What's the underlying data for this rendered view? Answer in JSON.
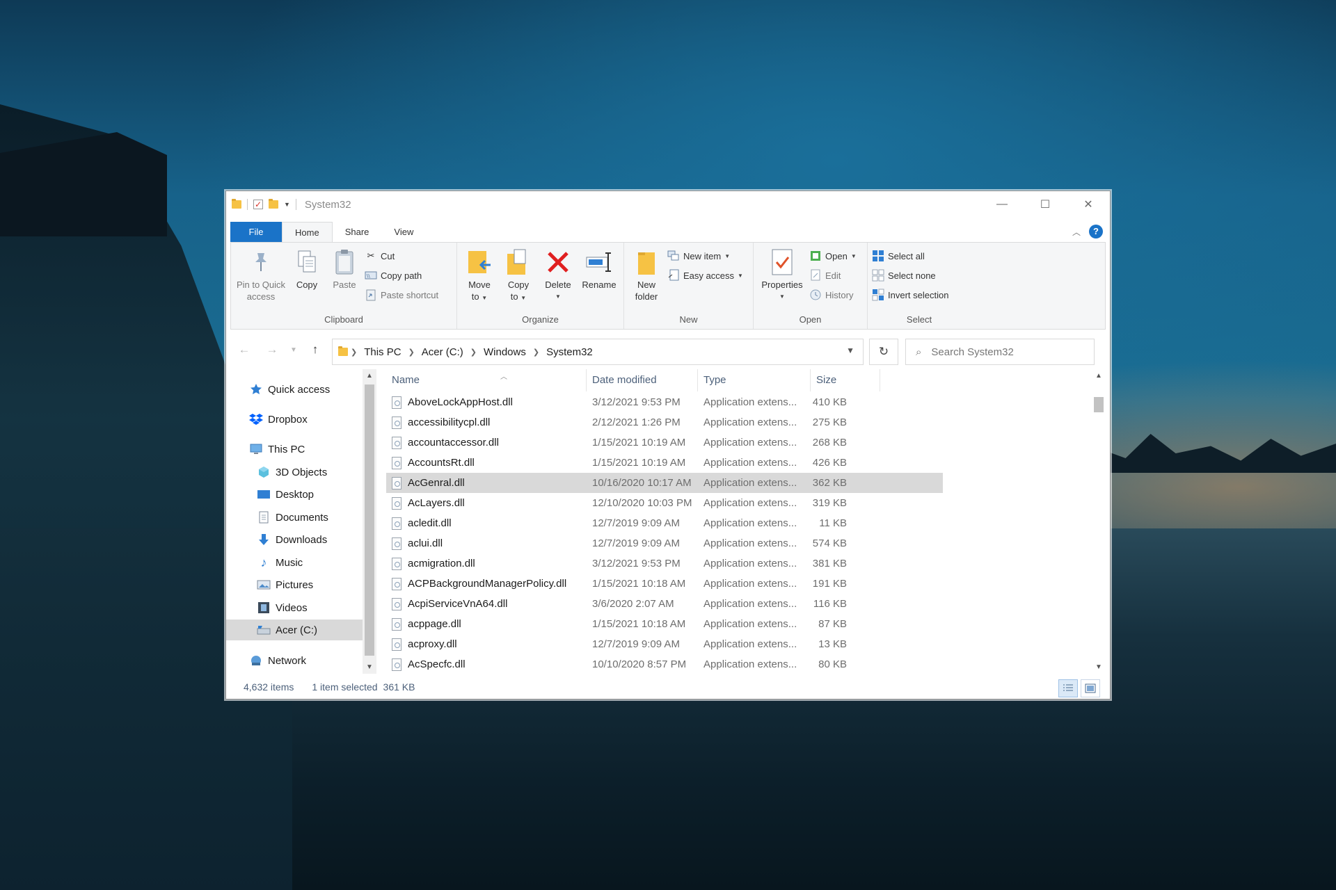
{
  "window": {
    "title": "System32",
    "controls": {
      "minimize": "—",
      "maximize": "☐",
      "close": "✕"
    }
  },
  "ribbon_tabs": [
    "File",
    "Home",
    "Share",
    "View"
  ],
  "ribbon": {
    "clipboard": {
      "label": "Clipboard",
      "pin_line1": "Pin to Quick",
      "pin_line2": "access",
      "copy": "Copy",
      "paste": "Paste",
      "cut": "Cut",
      "copy_path": "Copy path",
      "paste_shortcut": "Paste shortcut"
    },
    "organize": {
      "label": "Organize",
      "move_line1": "Move",
      "move_line2": "to",
      "copy_line1": "Copy",
      "copy_line2": "to",
      "delete": "Delete",
      "rename": "Rename"
    },
    "new": {
      "label": "New",
      "folder_line1": "New",
      "folder_line2": "folder",
      "new_item": "New item",
      "easy_access": "Easy access"
    },
    "open": {
      "label": "Open",
      "properties": "Properties",
      "open": "Open",
      "edit": "Edit",
      "history": "History"
    },
    "select": {
      "label": "Select",
      "select_all": "Select all",
      "select_none": "Select none",
      "invert": "Invert selection"
    }
  },
  "address": {
    "crumbs": [
      "This PC",
      "Acer (C:)",
      "Windows",
      "System32"
    ],
    "search_placeholder": "Search System32"
  },
  "nav": {
    "quick_access": "Quick access",
    "dropbox": "Dropbox",
    "this_pc": "This PC",
    "objects3d": "3D Objects",
    "desktop": "Desktop",
    "documents": "Documents",
    "downloads": "Downloads",
    "music": "Music",
    "pictures": "Pictures",
    "videos": "Videos",
    "drive": "Acer (C:)",
    "network": "Network"
  },
  "columns": {
    "name": "Name",
    "date": "Date modified",
    "type": "Type",
    "size": "Size"
  },
  "files": [
    {
      "name": "AboveLockAppHost.dll",
      "date": "3/12/2021 9:53 PM",
      "type": "Application extens...",
      "size": "410 KB"
    },
    {
      "name": "accessibilitycpl.dll",
      "date": "2/12/2021 1:26 PM",
      "type": "Application extens...",
      "size": "275 KB"
    },
    {
      "name": "accountaccessor.dll",
      "date": "1/15/2021 10:19 AM",
      "type": "Application extens...",
      "size": "268 KB"
    },
    {
      "name": "AccountsRt.dll",
      "date": "1/15/2021 10:19 AM",
      "type": "Application extens...",
      "size": "426 KB"
    },
    {
      "name": "AcGenral.dll",
      "date": "10/16/2020 10:17 AM",
      "type": "Application extens...",
      "size": "362 KB"
    },
    {
      "name": "AcLayers.dll",
      "date": "12/10/2020 10:03 PM",
      "type": "Application extens...",
      "size": "319 KB"
    },
    {
      "name": "acledit.dll",
      "date": "12/7/2019 9:09 AM",
      "type": "Application extens...",
      "size": "11 KB"
    },
    {
      "name": "aclui.dll",
      "date": "12/7/2019 9:09 AM",
      "type": "Application extens...",
      "size": "574 KB"
    },
    {
      "name": "acmigration.dll",
      "date": "3/12/2021 9:53 PM",
      "type": "Application extens...",
      "size": "381 KB"
    },
    {
      "name": "ACPBackgroundManagerPolicy.dll",
      "date": "1/15/2021 10:18 AM",
      "type": "Application extens...",
      "size": "191 KB"
    },
    {
      "name": "AcpiServiceVnA64.dll",
      "date": "3/6/2020 2:07 AM",
      "type": "Application extens...",
      "size": "116 KB"
    },
    {
      "name": "acppage.dll",
      "date": "1/15/2021 10:18 AM",
      "type": "Application extens...",
      "size": "87 KB"
    },
    {
      "name": "acproxy.dll",
      "date": "12/7/2019 9:09 AM",
      "type": "Application extens...",
      "size": "13 KB"
    },
    {
      "name": "AcSpecfc.dll",
      "date": "10/10/2020 8:57 PM",
      "type": "Application extens...",
      "size": "80 KB"
    }
  ],
  "selected_file": "AcGenral.dll",
  "status": {
    "items": "4,632 items",
    "selected": "1 item selected",
    "size": "361 KB"
  },
  "colors": {
    "accent": "#1a73c8",
    "selection": "#d9d9d9",
    "folder": "#f6c244",
    "delete_red": "#e02020"
  }
}
